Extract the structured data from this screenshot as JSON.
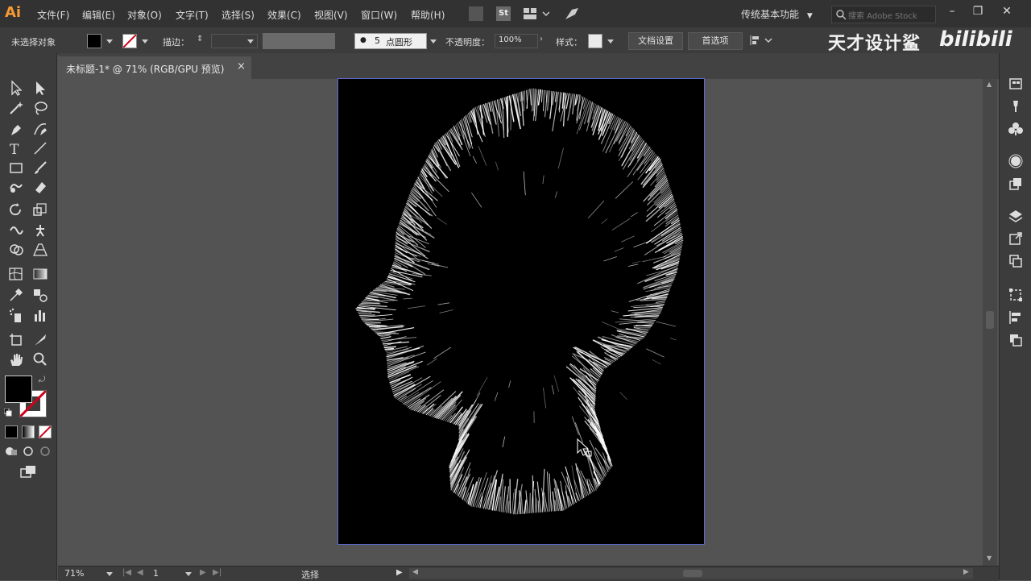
{
  "app": {
    "logo": "Ai",
    "accent": "#f79a32"
  },
  "menu": {
    "items": [
      "文件(F)",
      "编辑(E)",
      "对象(O)",
      "文字(T)",
      "选择(S)",
      "效果(C)",
      "视图(V)",
      "窗口(W)",
      "帮助(H)"
    ],
    "workspace": "传统基本功能",
    "search_placeholder": "搜索 Adobe Stock",
    "st_badge": "St"
  },
  "controlbar": {
    "selection_status": "未选择对象",
    "stroke_label": "描边：",
    "brush_size": "5",
    "brush_name": "点圆形",
    "opacity_label": "不透明度：",
    "opacity_value": "100%",
    "style_label": "样式：",
    "doc_settings": "文档设置",
    "preferences": "首选项"
  },
  "watermark": {
    "text": "天才设计鲨",
    "logo": "bilibili"
  },
  "document": {
    "tab_title": "未标题-1* @ 71% (RGB/GPU 预览)",
    "close_glyph": "×"
  },
  "statusbar": {
    "zoom": "71%",
    "artboard_number": "1",
    "tool_status": "选择"
  },
  "window": {
    "minimize": "–",
    "restore": "❐",
    "close": "✕"
  }
}
